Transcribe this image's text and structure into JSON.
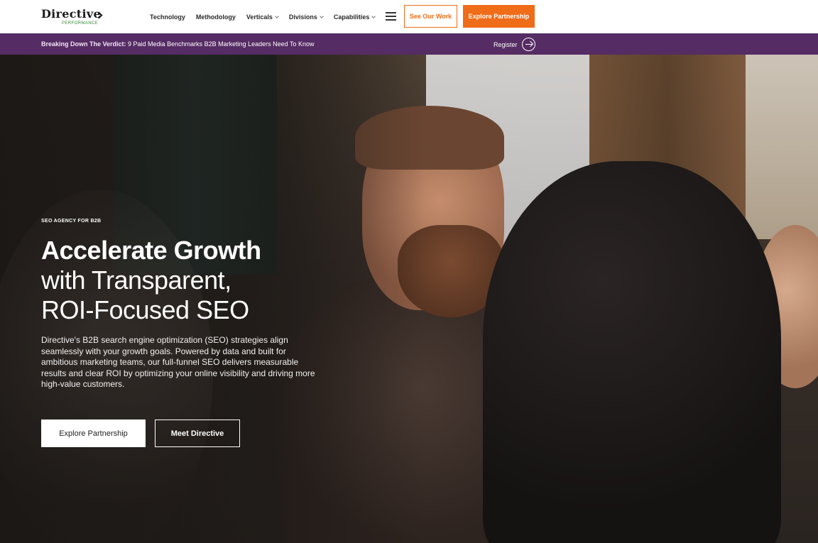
{
  "header": {
    "logo_text": "Directive",
    "logo_subtext": "PERFORMANCE",
    "nav": [
      {
        "label": "Technology",
        "has_dropdown": false
      },
      {
        "label": "Methodology",
        "has_dropdown": false
      },
      {
        "label": "Verticals",
        "has_dropdown": true
      },
      {
        "label": "Divisions",
        "has_dropdown": true
      },
      {
        "label": "Capabilities",
        "has_dropdown": true
      }
    ],
    "menu_icon": "hamburger-icon",
    "see_work_label": "See Our Work",
    "explore_label": "Explore Partnership",
    "accent_color": "#ef6c19"
  },
  "banner": {
    "bold_text": "Breaking Down The Verdict:",
    "text": " 9 Paid Media Benchmarks B2B Marketing Leaders Need To Know",
    "register_label": "Register",
    "register_icon": "arrow-right-circle-icon",
    "background_color": "#552c63"
  },
  "hero": {
    "eyebrow": "SEO AGENCY FOR B2B",
    "headline_line1": "Accelerate Growth",
    "headline_line2": "with Transparent,",
    "headline_line3": "ROI-Focused SEO",
    "description": "Directive's B2B search engine optimization (SEO) strategies align seamlessly with your growth goals. Powered by data and built for ambitious marketing teams, our full-funnel SEO delivers measurable results and clear ROI by optimizing your online visibility and driving more high-value customers.",
    "primary_button": "Explore Partnership",
    "secondary_button": "Meet Directive"
  }
}
